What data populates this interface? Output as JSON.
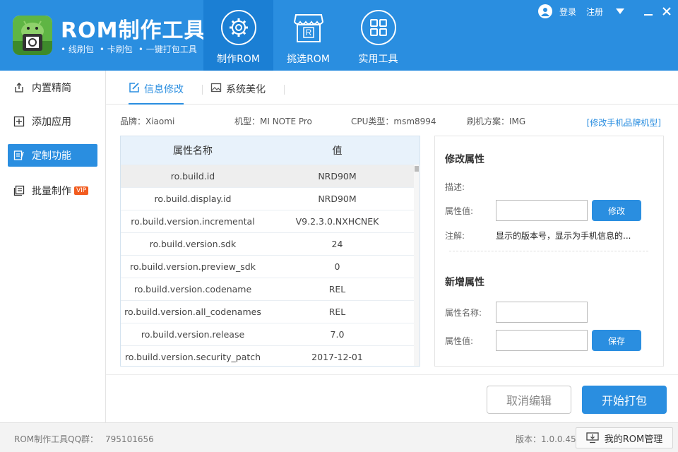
{
  "header": {
    "title": "ROM制作工具",
    "subtitle": [
      "• 线刷包",
      "• 卡刷包",
      "• 一键打包工具"
    ],
    "nav": [
      {
        "label": "制作ROM",
        "icon": "gear-icon",
        "active": true
      },
      {
        "label": "挑选ROM",
        "icon": "store-icon",
        "active": false
      },
      {
        "label": "实用工具",
        "icon": "grid-icon",
        "active": false
      }
    ],
    "login": "登录",
    "register": "注册"
  },
  "sidebar": {
    "items": [
      {
        "label": "内置精简",
        "icon": "export-icon"
      },
      {
        "label": "添加应用",
        "icon": "plus-box-icon"
      },
      {
        "label": "定制功能",
        "icon": "edit-doc-icon"
      },
      {
        "label": "批量制作",
        "icon": "batch-icon",
        "badge": "VIP"
      }
    ]
  },
  "tabs": [
    {
      "label": "信息修改",
      "icon": "edit-icon"
    },
    {
      "label": "系统美化",
      "icon": "image-icon"
    }
  ],
  "info": {
    "brand": "品牌：Xiaomi",
    "model": "机型：MI NOTE Pro",
    "cpu": "CPU类型：msm8994",
    "flash": "刷机方案：IMG",
    "modify_link": "[修改手机品牌机型]"
  },
  "table": {
    "headers": [
      "属性名称",
      "值"
    ],
    "rows": [
      {
        "name": "ro.build.id",
        "value": "NRD90M"
      },
      {
        "name": "ro.build.display.id",
        "value": "NRD90M"
      },
      {
        "name": "ro.build.version.incremental",
        "value": "V9.2.3.0.NXHCNEK"
      },
      {
        "name": "ro.build.version.sdk",
        "value": "24"
      },
      {
        "name": "ro.build.version.preview_sdk",
        "value": "0"
      },
      {
        "name": "ro.build.version.codename",
        "value": "REL"
      },
      {
        "name": "ro.build.version.all_codenames",
        "value": "REL"
      },
      {
        "name": "ro.build.version.release",
        "value": "7.0"
      },
      {
        "name": "ro.build.version.security_patch",
        "value": "2017-12-01"
      }
    ]
  },
  "panel": {
    "modify_title": "修改属性",
    "desc_label": "描述:",
    "value_label": "属性值:",
    "modify_button": "修改",
    "note_label": "注解:",
    "note_text": "显示的版本号，显示为手机信息的...",
    "add_title": "新增属性",
    "name_label": "属性名称:",
    "add_value_label": "属性值:",
    "save_button": "保存"
  },
  "actions": {
    "cancel": "取消编辑",
    "start": "开始打包"
  },
  "status": {
    "qq_label": "ROM制作工具QQ群：",
    "qq_number": "795101656",
    "version": "版本：1.0.0.45",
    "rom_manager": "我的ROM管理"
  },
  "colors": {
    "primary": "#2a8ee0",
    "nav_active": "#1b7fd4",
    "vip": "#f25c1f"
  }
}
